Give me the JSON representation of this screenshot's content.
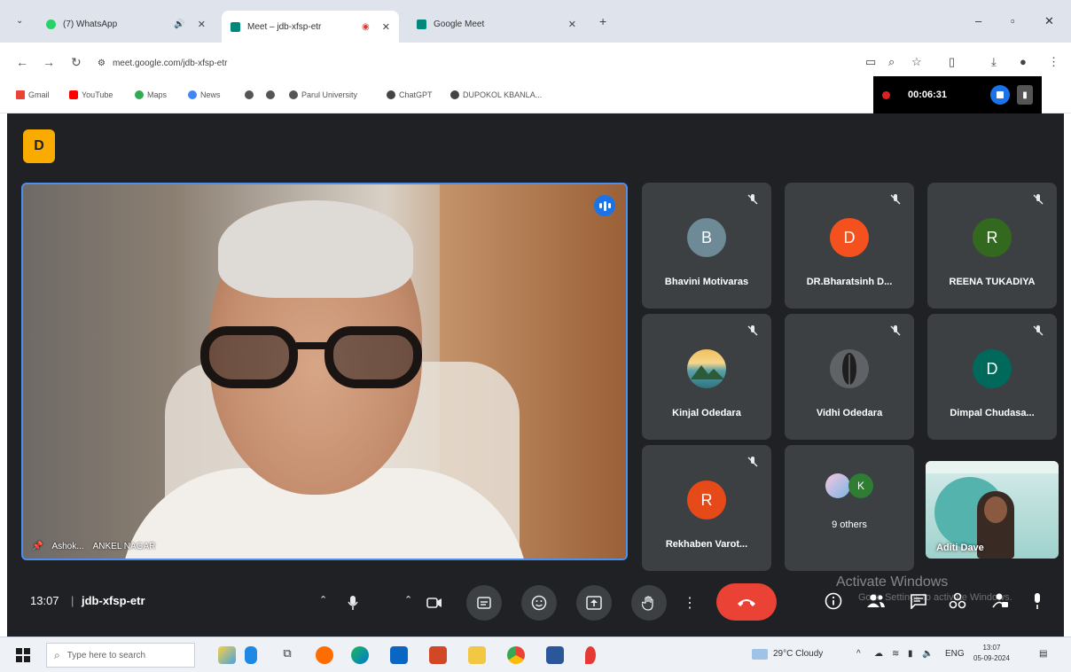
{
  "browser": {
    "tabs": [
      {
        "label": "(7) WhatsApp",
        "favicon_color": "#25d366"
      },
      {
        "label": "Meet – jdb-xfsp-etr",
        "favicon_color": "#00897b"
      },
      {
        "label": "Google Meet",
        "favicon_color": "#00897b"
      }
    ],
    "url": "meet.google.com/jdb-xfsp-etr",
    "bookmarks": [
      {
        "label": "Gmail",
        "color": "#ea4335"
      },
      {
        "label": "YouTube",
        "color": "#ff0000"
      },
      {
        "label": "Maps",
        "color": "#34a853"
      },
      {
        "label": "News",
        "color": "#4285f4"
      },
      {
        "label": "Parul University",
        "color": "#666666"
      },
      {
        "label": "ChatGPT",
        "color": "#444444"
      },
      {
        "label": "DUPOKOL KBANLA...",
        "color": "#444444"
      }
    ]
  },
  "recording": {
    "time": "00:06:31"
  },
  "meet": {
    "logo_letter": "D",
    "speaker_name_a": "Ashok...",
    "speaker_name_b": "ANKEL NAGAR",
    "participants": [
      {
        "name": "Bhavini Motivaras",
        "initial": "B",
        "color": "#6d8a96",
        "type": "initial"
      },
      {
        "name": "DR.Bharatsinh D...",
        "initial": "D",
        "color": "#f4511e",
        "type": "initial"
      },
      {
        "name": "REENA TUKADIYA",
        "initial": "R",
        "color": "#33691e",
        "type": "initial"
      },
      {
        "name": "Kinjal Odedara",
        "type": "photo"
      },
      {
        "name": "Vidhi Odedara",
        "type": "photo"
      },
      {
        "name": "Dimpal Chudasa...",
        "initial": "D",
        "color": "#00695c",
        "type": "initial"
      },
      {
        "name": "Rekhaben Varot...",
        "initial": "R",
        "color": "#e64a19",
        "type": "initial"
      },
      {
        "name": "9 others",
        "initial": "K",
        "color": "#2e7d32",
        "type": "others"
      }
    ],
    "video_participant": "Aditi Dave",
    "clock": "13:07",
    "meeting_code": "jdb-xfsp-etr",
    "watermark_line1": "Activate Windows",
    "watermark_line2": "Go to Settings to activate Windows."
  },
  "taskbar": {
    "search_placeholder": "Type here to search",
    "weather": "29°C Cloudy",
    "lang": "ENG",
    "time": "13:07",
    "date": "05-09-2024"
  }
}
